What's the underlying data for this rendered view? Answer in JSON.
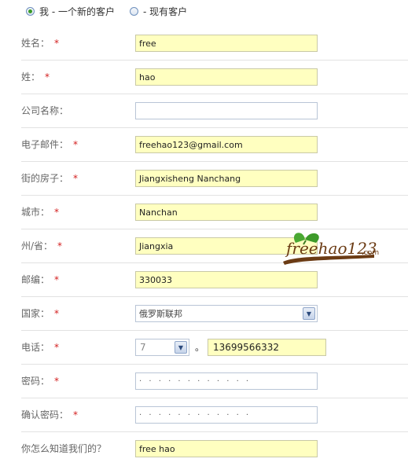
{
  "customer_type": {
    "new_label": "我 - 一个新的客户",
    "existing_label": "- 现有客户"
  },
  "form": {
    "first_name": {
      "label": "姓名：",
      "value": "free"
    },
    "last_name": {
      "label": "姓：",
      "value": "hao"
    },
    "company": {
      "label": "公司名称：",
      "value": ""
    },
    "email": {
      "label": "电子邮件：",
      "value": "freehao123@gmail.com"
    },
    "street": {
      "label": "街的房子：",
      "value": "Jiangxisheng Nanchang"
    },
    "city": {
      "label": "城市：",
      "value": "Nanchan"
    },
    "state": {
      "label": "州/省：",
      "value": "Jiangxia"
    },
    "zip": {
      "label": "邮编：",
      "value": "330033"
    },
    "country": {
      "label": "国家：",
      "value": "俄罗斯联邦"
    },
    "phone": {
      "label": "电话：",
      "country_code": "7",
      "separator": "。",
      "value": "13699566332"
    },
    "password": {
      "label": "密码：",
      "value": "· · · · · · · · · · · ·"
    },
    "confirm_password": {
      "label": "确认密码：",
      "value": "· · · · · · · · · · · ·"
    },
    "referral": {
      "label": "你怎么知道我们的？",
      "value": "free hao"
    },
    "required_mark": "*"
  },
  "watermark": {
    "text": "freehao123",
    "suffix": ".com"
  },
  "colors": {
    "filled_bg": "#ffffc0",
    "required": "#d32020",
    "logo_green": "#3d9a2a",
    "logo_brown": "#6b3b14"
  }
}
